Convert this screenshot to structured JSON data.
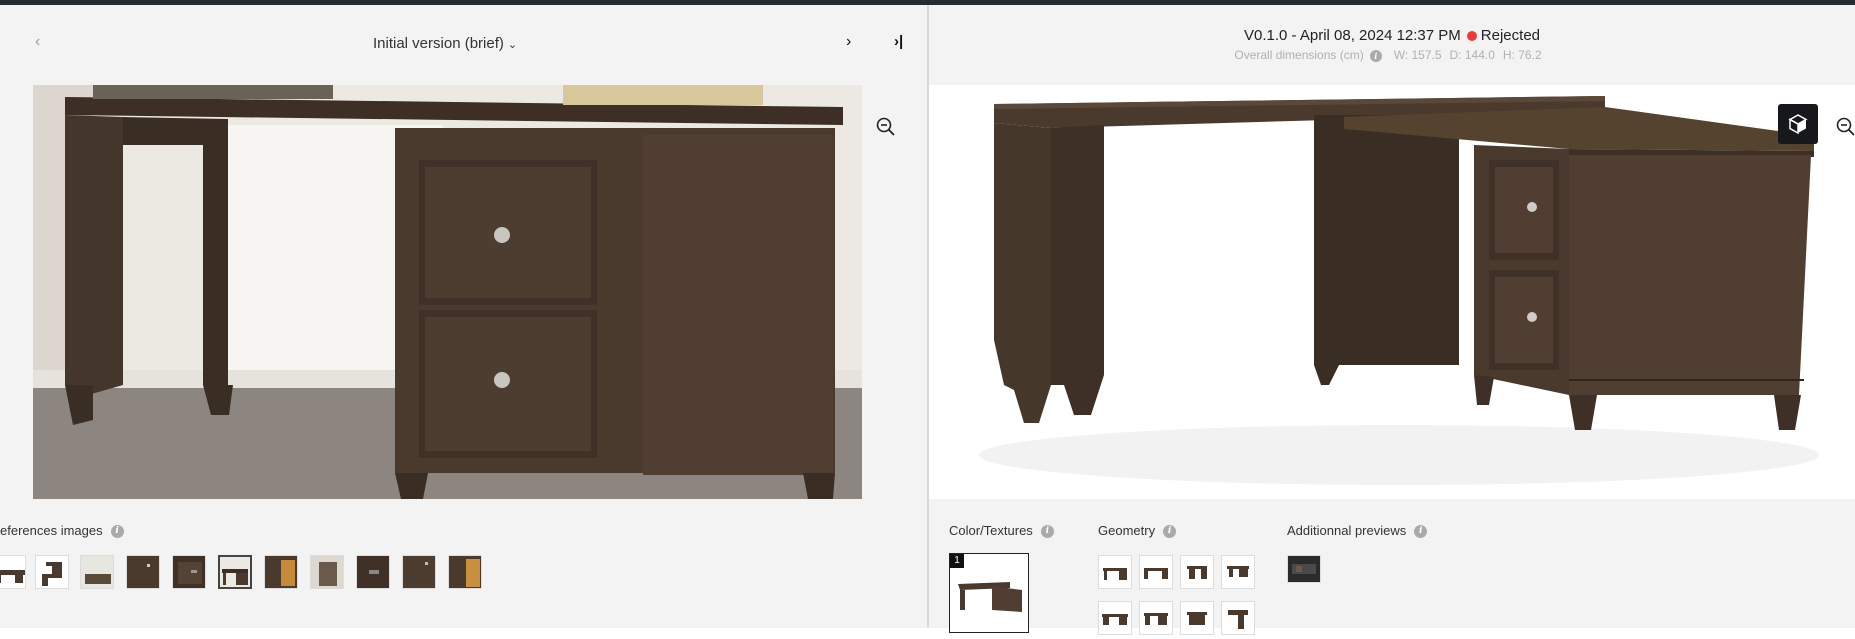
{
  "left_panel": {
    "version_selector": "Initial version (brief)",
    "prev_icon": "chevron-left-icon",
    "next_icon": "chevron-right-icon",
    "last_icon": "skip-to-last-icon",
    "zoom_icon": "zoom-out-icon",
    "reference_label": "eferences images",
    "thumbnail_count": 11,
    "selected_thumbnail": 5
  },
  "right_panel": {
    "version": "V0.1.0 - April 08, 2024 12:37 PM",
    "status": "Rejected",
    "status_color": "#ee3a3a",
    "dimensions_label": "Overall dimensions (cm)",
    "width": "W: 157.5",
    "depth": "D: 144.0",
    "height": "H: 76.2",
    "cube_icon": "3d-cube-icon",
    "zoom_icon": "zoom-out-icon",
    "sections": {
      "color_textures": "Color/Textures",
      "geometry": "Geometry",
      "additional_previews": "Additionnal previews"
    },
    "color_thumb_badge": "1"
  },
  "colors": {
    "accent_dark": "#16181c",
    "wood": "#4a3a2e",
    "background": "#f3f3f3"
  }
}
